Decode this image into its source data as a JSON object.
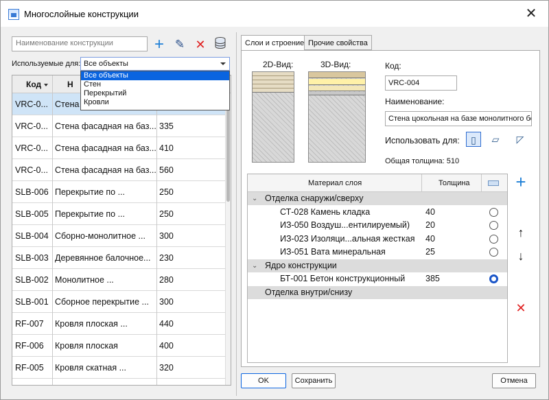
{
  "window": {
    "title": "Многослойные конструкции"
  },
  "toolbar": {
    "search_placeholder": "Наименование конструкции",
    "used_for_label": "Используемые для:",
    "used_for_value": "Все объекты",
    "used_for_options": [
      "Все объекты",
      "Стен",
      "Перекрытий",
      "Кровли"
    ]
  },
  "list": {
    "columns": [
      "Код",
      "Н"
    ],
    "rows": [
      {
        "code": "VRC-0...",
        "name": "Стена ф",
        "thickness": ""
      },
      {
        "code": "VRC-0...",
        "name": "Стена фасадная на баз...",
        "thickness": "335"
      },
      {
        "code": "VRC-0...",
        "name": "Стена фасадная на баз...",
        "thickness": "410"
      },
      {
        "code": "VRC-0...",
        "name": "Стена фасадная на баз...",
        "thickness": "560"
      },
      {
        "code": "SLB-006",
        "name": "Перекрытие по ...",
        "thickness": "250"
      },
      {
        "code": "SLB-005",
        "name": "Перекрытие по ...",
        "thickness": "250"
      },
      {
        "code": "SLB-004",
        "name": "Сборно-монолитное ...",
        "thickness": "300"
      },
      {
        "code": "SLB-003",
        "name": "Деревянное балочное...",
        "thickness": "230"
      },
      {
        "code": "SLB-002",
        "name": "Монолитное ...",
        "thickness": "280"
      },
      {
        "code": "SLB-001",
        "name": "Сборное перекрытие ...",
        "thickness": "300"
      },
      {
        "code": "RF-007",
        "name": "Кровля плоская ...",
        "thickness": "440"
      },
      {
        "code": "RF-006",
        "name": "Кровля плоская",
        "thickness": "400"
      },
      {
        "code": "RF-005",
        "name": "Кровля скатная ...",
        "thickness": "320"
      }
    ]
  },
  "tabs": [
    "Слои и строение",
    "Прочие свойства"
  ],
  "details": {
    "view2d_label": "2D-Вид:",
    "view3d_label": "3D-Вид:",
    "code_label": "Код:",
    "code_value": "VRC-004",
    "name_label": "Наименование:",
    "name_value": "Стена цокольная на базе монолитного бет",
    "use_for_label": "Использовать для:",
    "total_label": "Общая толщина:",
    "total_value": "510"
  },
  "layers": {
    "col_material": "Материал слоя",
    "col_thickness": "Толщина",
    "groups": [
      {
        "name": "Отделка снаружи/сверху",
        "items": [
          {
            "name": "СТ-028 Камень кладка",
            "thickness": "40",
            "core": false
          },
          {
            "name": "ИЗ-050 Воздуш...ентилируемый)",
            "thickness": "20",
            "core": false
          },
          {
            "name": "ИЗ-023 Изоляци...альная жесткая",
            "thickness": "40",
            "core": false
          },
          {
            "name": "ИЗ-051 Вата минеральная",
            "thickness": "25",
            "core": false
          }
        ]
      },
      {
        "name": "Ядро конструкции",
        "items": [
          {
            "name": "БТ-001 Бетон конструкционный",
            "thickness": "385",
            "core": true
          }
        ]
      },
      {
        "name": "Отделка внутри/снизу",
        "items": []
      }
    ]
  },
  "buttons": {
    "ok": "OK",
    "save": "Сохранить",
    "cancel": "Отмена"
  },
  "colors": {
    "accent": "#0a64e0",
    "add": "#1e7fd6",
    "delete": "#e02020",
    "selected_row": "#cfe4f7"
  }
}
